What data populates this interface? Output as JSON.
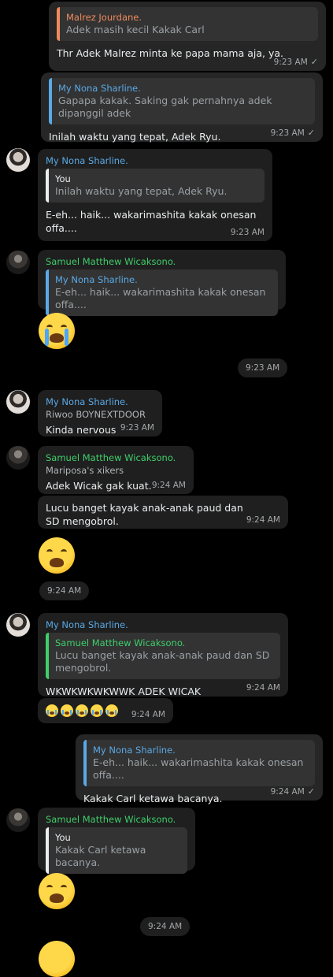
{
  "colors": {
    "blue_name": "#5aa9e6",
    "green_name": "#3ecf6a",
    "orange_bar": "#f08a5d",
    "white_bar": "#e9edef"
  },
  "messages": [
    {
      "quote_author": "Malrez  Jourdane.",
      "quote_text": "Adek masih kecil Kakak Carl",
      "text": "Thr Adek Malrez minta ke papa mama aja, ya.",
      "time": "9:23 AM"
    },
    {
      "quote_author": "My Nona Sharline.",
      "quote_text": "Gapapa kakak. Saking gak pernahnya adek dipanggil adek",
      "text": "Inilah waktu yang tepat, Adek Ryu.",
      "time": "9:23 AM"
    },
    {
      "sender": "My Nona Sharline.",
      "quote_author": "You",
      "quote_text": "Inilah waktu yang tepat, Adek Ryu.",
      "text": "E-eh... haik... wakarimashita kakak onesan offa....",
      "time": "9:23 AM"
    },
    {
      "sender": "Samuel Matthew Wicaksono.",
      "quote_author": "My Nona Sharline.",
      "quote_text": "E-eh... haik... wakarimashita kakak onesan offa....",
      "time": "9:23 AM"
    },
    {
      "sender": "My Nona Sharline.",
      "sub": "Riwoo BOYNEXTDOOR",
      "text": "Kinda nervous",
      "time": "9:23 AM"
    },
    {
      "sender": "Samuel Matthew Wicaksono.",
      "sub": "Mariposa's xikers",
      "text": "Adek Wicak gak kuat.",
      "time": "9:24 AM"
    },
    {
      "text": "Lucu banget kayak anak-anak paud dan SD mengobrol.",
      "time": "9:24 AM"
    },
    {
      "time": "9:24 AM"
    },
    {
      "sender": "My Nona Sharline.",
      "quote_author": "Samuel Matthew Wicaksono.",
      "quote_text": "Lucu banget kayak anak-anak paud dan SD mengobrol.",
      "text": "WKWKWKWKWWK ADEK WICAK",
      "time": "9:24 AM"
    },
    {
      "time": "9:24 AM"
    },
    {
      "quote_author": "My Nona Sharline.",
      "quote_text": "E-eh... haik... wakarimashita kakak onesan offa....",
      "text": "Kakak Carl ketawa bacanya.",
      "time": "9:24 AM"
    },
    {
      "sender": "Samuel Matthew Wicaksono.",
      "quote_author": "You",
      "quote_text": "Kakak Carl ketawa bacanya.",
      "time": "9:24 AM"
    }
  ],
  "tick_icon": "✓"
}
